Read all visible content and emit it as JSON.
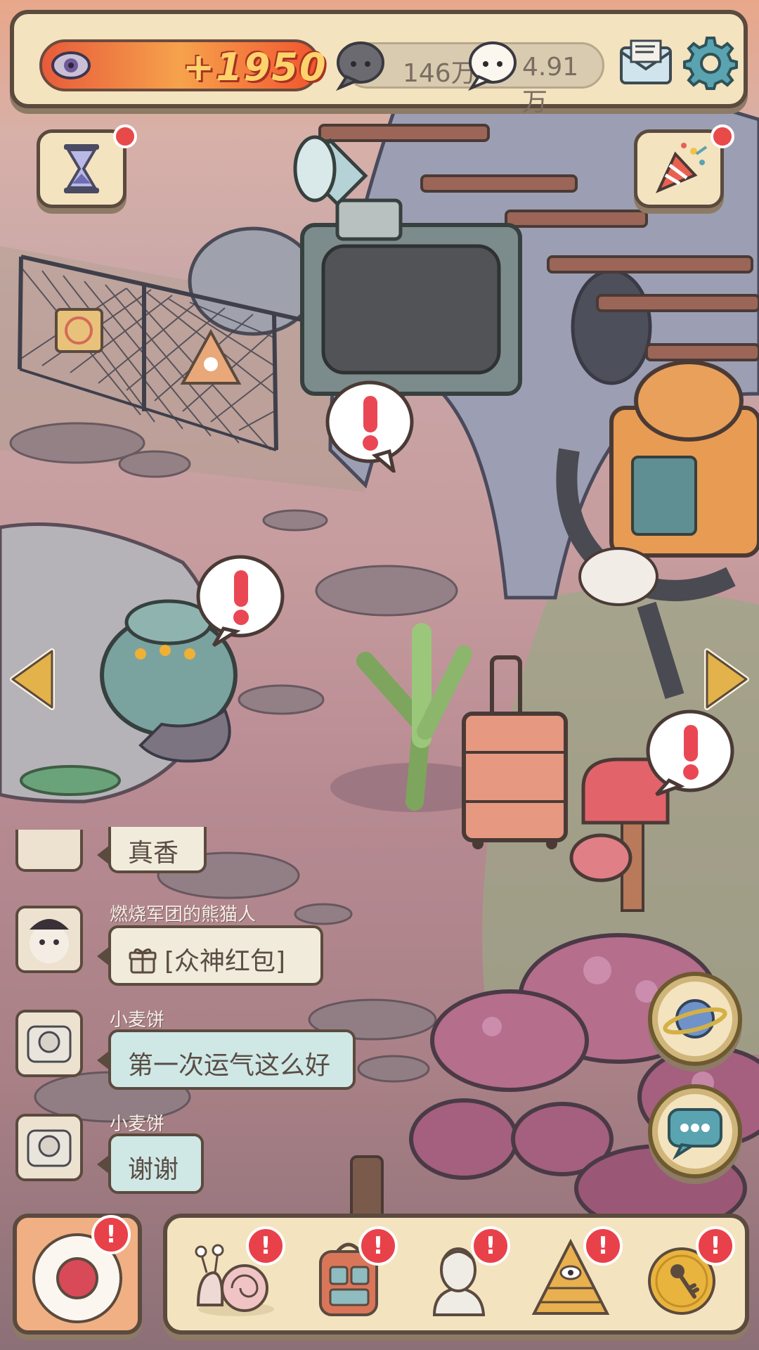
{
  "top": {
    "fire_value": "+1950",
    "chat_count": "146万",
    "likes_count": "4.91万",
    "icons": [
      "eye-icon",
      "dark-speech-bubble-icon",
      "light-speech-bubble-icon",
      "mail-icon",
      "gear-icon"
    ]
  },
  "side_buttons": {
    "hourglass": "hourglass-icon",
    "party": "party-popper-icon",
    "planet": "planet-icon",
    "chat": "chat-icon"
  },
  "chat": {
    "messages": [
      {
        "user": "",
        "text": "真香",
        "style": "cream"
      },
      {
        "user": "燃烧军团的熊猫人",
        "text": "[众神红包]",
        "style": "cream",
        "gift_icon": "gift-icon"
      },
      {
        "user": "小麦饼",
        "text": "第一次运气这么好",
        "style": "teal"
      },
      {
        "user": "小麦饼",
        "text": "谢谢",
        "style": "teal"
      }
    ]
  },
  "dock": {
    "badge_text": "!",
    "items": [
      "camera-icon",
      "snail-icon",
      "backpack-icon",
      "statue-icon",
      "pyramid-eye-icon",
      "coin-key-icon"
    ]
  },
  "scene": {
    "alert_text": "!",
    "objects": [
      "chain-fence",
      "skull-warning-sign",
      "tv-monitor",
      "megaphone",
      "robot-cat",
      "pot-robot",
      "leek",
      "suitcase",
      "mailbox",
      "mushrooms",
      "pond"
    ]
  }
}
